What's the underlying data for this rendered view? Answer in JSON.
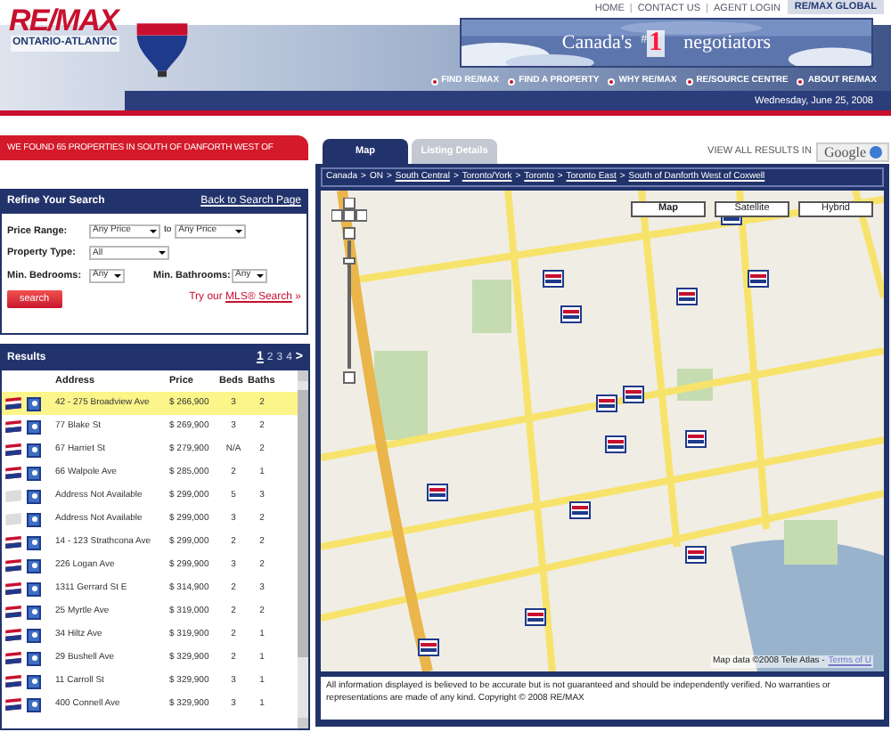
{
  "header": {
    "logo": "RE/MAX",
    "region": "ONTARIO-ATLANTIC",
    "top_links": [
      "HOME",
      "CONTACT US",
      "AGENT LOGIN"
    ],
    "link_separator": "|",
    "global_button": "RE/MAX GLOBAL",
    "banner": {
      "before": "Canada's",
      "mark": "#",
      "number": "1",
      "after": "negotiators"
    },
    "nav": [
      "FIND RE/MAX",
      "FIND A PROPERTY",
      "WHY RE/MAX",
      "RE/SOURCE CENTRE",
      "ABOUT RE/MAX"
    ],
    "date": "Wednesday, June 25, 2008"
  },
  "found_banner": "WE FOUND 65 PROPERTIES IN SOUTH OF DANFORTH WEST OF",
  "refine": {
    "title": "Refine Your Search",
    "back_link": "Back to Search Page",
    "price_label": "Price Range:",
    "price_from": "Any Price",
    "price_to_word": "to",
    "price_to": "Any Price",
    "type_label": "Property Type:",
    "type_value": "All",
    "beds_label": "Min. Bedrooms:",
    "beds_value": "Any",
    "baths_label": "Min. Bathrooms:",
    "baths_value": "Any",
    "search_button": "search",
    "try_text": "Try our",
    "mls_link": "MLS® Search",
    "try_arrow": "»"
  },
  "results": {
    "title": "Results",
    "pages": [
      {
        "label": "1",
        "selected": true
      },
      {
        "label": "2",
        "selected": false
      },
      {
        "label": "3",
        "selected": false
      },
      {
        "label": "4",
        "selected": false
      }
    ],
    "next": ">",
    "columns": [
      "Address",
      "Price",
      "Beds",
      "Baths"
    ],
    "rows": [
      {
        "address": "42 - 275 Broadview Ave",
        "price": "$ 266,900",
        "beds": "3",
        "baths": "2",
        "selected": true,
        "flag_active": true
      },
      {
        "address": "77 Blake St",
        "price": "$ 269,900",
        "beds": "3",
        "baths": "2",
        "selected": false,
        "flag_active": true
      },
      {
        "address": "67 Harriet St",
        "price": "$ 279,900",
        "beds": "N/A",
        "baths": "2",
        "selected": false,
        "flag_active": true
      },
      {
        "address": "66 Walpole Ave",
        "price": "$ 285,000",
        "beds": "2",
        "baths": "1",
        "selected": false,
        "flag_active": true
      },
      {
        "address": "Address Not Available",
        "price": "$ 299,000",
        "beds": "5",
        "baths": "3",
        "selected": false,
        "flag_active": false
      },
      {
        "address": "Address Not Available",
        "price": "$ 299,000",
        "beds": "3",
        "baths": "2",
        "selected": false,
        "flag_active": false
      },
      {
        "address": "14 - 123 Strathcona Ave",
        "price": "$ 299,000",
        "beds": "2",
        "baths": "2",
        "selected": false,
        "flag_active": true
      },
      {
        "address": "226 Logan Ave",
        "price": "$ 299,900",
        "beds": "3",
        "baths": "2",
        "selected": false,
        "flag_active": true
      },
      {
        "address": "1311 Gerrard St E",
        "price": "$ 314,900",
        "beds": "2",
        "baths": "3",
        "selected": false,
        "flag_active": true
      },
      {
        "address": "25 Myrtle Ave",
        "price": "$ 319,000",
        "beds": "2",
        "baths": "2",
        "selected": false,
        "flag_active": true
      },
      {
        "address": "34 Hiltz Ave",
        "price": "$ 319,900",
        "beds": "2",
        "baths": "1",
        "selected": false,
        "flag_active": true
      },
      {
        "address": "29 Bushell Ave",
        "price": "$ 329,900",
        "beds": "2",
        "baths": "1",
        "selected": false,
        "flag_active": true
      },
      {
        "address": "11 Carroll St",
        "price": "$ 329,900",
        "beds": "3",
        "baths": "1",
        "selected": false,
        "flag_active": true
      },
      {
        "address": "400 Connell Ave",
        "price": "$ 329,900",
        "beds": "3",
        "baths": "1",
        "selected": false,
        "flag_active": true
      }
    ]
  },
  "tabs": [
    {
      "label": "Map",
      "selected": true
    },
    {
      "label": "Listing Details",
      "selected": false
    }
  ],
  "view_all": "VIEW ALL RESULTS IN",
  "google_earth": "Google",
  "breadcrumb": [
    {
      "label": "Canada",
      "link": false
    },
    {
      "label": "ON",
      "link": false
    },
    {
      "label": "South Central",
      "link": true
    },
    {
      "label": "Toronto/York",
      "link": true
    },
    {
      "label": "Toronto",
      "link": true
    },
    {
      "label": "Toronto East",
      "link": true
    },
    {
      "label": "South of Danforth West of Coxwell",
      "link": true
    }
  ],
  "breadcrumb_separator": ">",
  "map": {
    "kind": "picture",
    "map_types": [
      {
        "label": "Map",
        "selected": true
      },
      {
        "label": "Satellite",
        "selected": false
      },
      {
        "label": "Hybrid",
        "selected": false
      }
    ],
    "attribution": "Map data ©2008 Tele Atlas -",
    "terms_link": "Terms of U"
  },
  "disclaimer": "All information displayed is believed to be accurate but is not guaranteed and should be independently verified. No warranties or representations are made of any kind. Copyright © 2008 RE/MAX"
}
